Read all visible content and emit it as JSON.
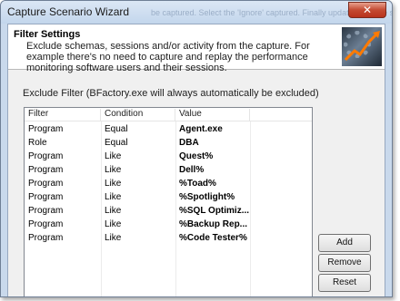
{
  "window": {
    "title": "Capture Scenario Wizard",
    "ghost_text": "be captured. Select the 'Ignore' captured. Finally updated. Please select an action",
    "close_symbol": "✕"
  },
  "header": {
    "title": "Filter Settings",
    "description": "Exclude schemas, sessions and/or activity from the capture. For example there's no need to capture and replay the performance monitoring software users and their sessions.",
    "graphic_icon": "performance-chart-gear-icon"
  },
  "exclude_label": "Exclude Filter  (BFactory.exe will always automatically be excluded)",
  "table": {
    "columns": [
      "Filter",
      "Condition",
      "Value"
    ],
    "rows": [
      {
        "filter": "Program",
        "condition": "Equal",
        "value": "Agent.exe"
      },
      {
        "filter": "Role",
        "condition": "Equal",
        "value": "DBA"
      },
      {
        "filter": "Program",
        "condition": "Like",
        "value": "Quest%"
      },
      {
        "filter": "Program",
        "condition": "Like",
        "value": "Dell%"
      },
      {
        "filter": "Program",
        "condition": "Like",
        "value": "%Toad%"
      },
      {
        "filter": "Program",
        "condition": "Like",
        "value": "%Spotlight%"
      },
      {
        "filter": "Program",
        "condition": "Like",
        "value": "%SQL Optimiz..."
      },
      {
        "filter": "Program",
        "condition": "Like",
        "value": "%Backup Rep..."
      },
      {
        "filter": "Program",
        "condition": "Like",
        "value": "%Code Tester%"
      }
    ]
  },
  "buttons": {
    "add": "Add",
    "remove": "Remove",
    "reset": "Reset"
  }
}
